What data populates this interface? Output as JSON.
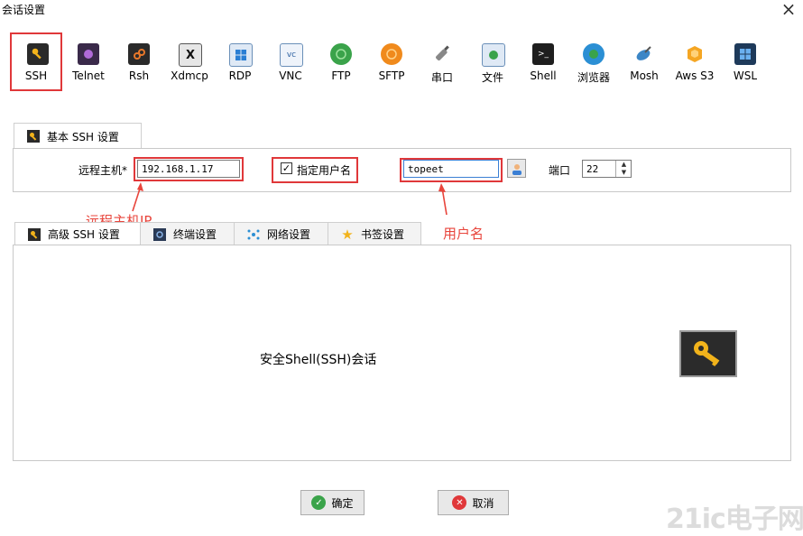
{
  "window": {
    "title": "会话设置",
    "close": "×"
  },
  "session_types": [
    {
      "label": "SSH",
      "icon": "key-icon"
    },
    {
      "label": "Telnet",
      "icon": "telnet-icon"
    },
    {
      "label": "Rsh",
      "icon": "rsh-icon"
    },
    {
      "label": "Xdmcp",
      "icon": "x-display-icon"
    },
    {
      "label": "RDP",
      "icon": "windows-icon"
    },
    {
      "label": "VNC",
      "icon": "vnc-icon"
    },
    {
      "label": "FTP",
      "icon": "globe-icon"
    },
    {
      "label": "SFTP",
      "icon": "sftp-icon"
    },
    {
      "label": "串口",
      "icon": "serial-plug-icon"
    },
    {
      "label": "文件",
      "icon": "file-icon"
    },
    {
      "label": "Shell",
      "icon": "terminal-icon"
    },
    {
      "label": "浏览器",
      "icon": "browser-icon"
    },
    {
      "label": "Mosh",
      "icon": "satellite-icon"
    },
    {
      "label": "Aws S3",
      "icon": "aws-icon"
    },
    {
      "label": "WSL",
      "icon": "windows-icon"
    }
  ],
  "basic": {
    "tab_label": "基本 SSH 设置",
    "remote_host_label": "远程主机*",
    "remote_host_value": "192.168.1.17",
    "specify_user_label": "指定用户名",
    "specify_user_checked": true,
    "username_value": "topeet",
    "port_label": "端口",
    "port_value": "22"
  },
  "annotations": {
    "host_ip": "远程主机IP",
    "username": "用户名"
  },
  "advanced_tabs": [
    {
      "label": "高级 SSH 设置",
      "icon": "key-icon"
    },
    {
      "label": "终端设置",
      "icon": "terminal-settings-icon"
    },
    {
      "label": "网络设置",
      "icon": "network-icon"
    },
    {
      "label": "书签设置",
      "icon": "star-icon"
    }
  ],
  "main_panel": {
    "description": "安全Shell(SSH)会话"
  },
  "buttons": {
    "ok": "确定",
    "cancel": "取消"
  },
  "watermark": "21ic电子网",
  "colors": {
    "highlight": "#e0383a",
    "annotation": "#e8453c",
    "key_yellow": "#f2b31b"
  }
}
